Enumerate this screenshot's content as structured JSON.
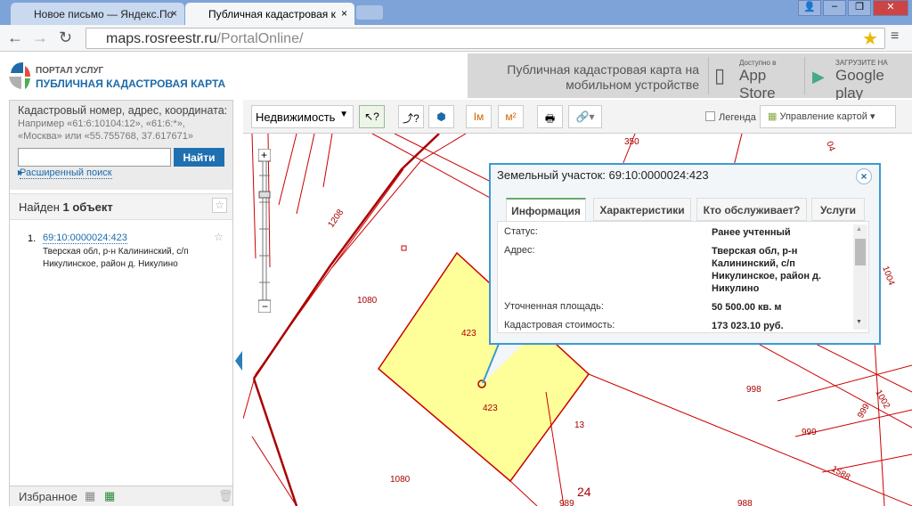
{
  "browser": {
    "tabs": [
      {
        "label": "Новое письмо — Яндекс.По"
      },
      {
        "label": "Публичная кадастровая к"
      }
    ],
    "url_host": "maps.rosreestr.ru",
    "url_path": "/PortalOnline/"
  },
  "header": {
    "portal": "ПОРТАЛ УСЛУГ",
    "title": "ПУБЛИЧНАЯ КАДАСТРОВАЯ КАРТА",
    "mobile_text": "Публичная кадастровая карта на мобильном устройстве",
    "appstore_small": "Доступно в",
    "appstore": "App Store",
    "gplay_small": "ЗАГРУЗИТЕ НА",
    "gplay": "Google play"
  },
  "search": {
    "label": "Кадастровый номер, адрес, координата:",
    "hint": "Например «61:6:10104:12», «61:6:*», «Москва» или «55.755768, 37.617671»",
    "value": "",
    "button": "Найти",
    "advanced": "Расширенный поиск"
  },
  "results": {
    "found_prefix": "Найден ",
    "found_count": "1 объект",
    "items": [
      {
        "num": "1.",
        "link": "69:10:0000024:423",
        "address": "Тверская обл, р-н Калининский, с/п Никулинское, район д. Никулино"
      }
    ]
  },
  "favorites": {
    "label": "Избранное"
  },
  "toolbar": {
    "layer_select": "Недвижимость",
    "legend": "Легенда",
    "map_control": "Управление картой",
    "legend_checked": false
  },
  "popup": {
    "title": "Земельный участок: 69:10:0000024:423",
    "tabs": [
      "Информация",
      "Характеристики",
      "Кто обслуживает?",
      "Услуги"
    ],
    "active_tab": 0,
    "rows": [
      {
        "label": "Статус:",
        "value": "Ранее учтенный"
      },
      {
        "label": "Адрес:",
        "value": "Тверская обл, р-н Калининский, с/п Никулинское, район д. Никулино"
      },
      {
        "label": "Уточненная площадь:",
        "value": "50 500.00 кв. м"
      },
      {
        "label": "Кадастровая стоимость:",
        "value": "173 023.10 руб."
      }
    ]
  },
  "map": {
    "labels": [
      "350",
      "1208",
      "1080",
      "423",
      "423",
      "13",
      "1080",
      "24",
      "998",
      "999",
      "1002",
      "999",
      "1588",
      "1004",
      "989",
      "988",
      "04"
    ],
    "parcel_color": "#ffff99",
    "line_color": "#c00000"
  }
}
